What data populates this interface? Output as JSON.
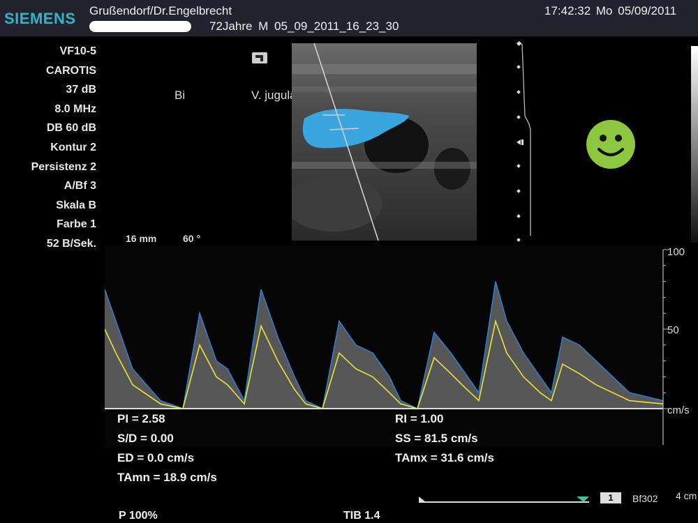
{
  "header": {
    "brand": "SIEMENS",
    "patient_name": "Grußendorf/Dr.Engelbrecht",
    "study_line": "72Jahre  M  05_09_2011_16_23_30",
    "datetime": "17:42:32  Mo  05/09/2011"
  },
  "params": [
    "VF10-5",
    "CAROTIS",
    "37 dB",
    "8.0 MHz",
    "DB 60 dB",
    "Kontur 2",
    "Persistenz 2",
    "A/Bf 3",
    "Skala B",
    "Farbe 1",
    "52 B/Sek."
  ],
  "image_labels": {
    "side": "Bi",
    "vessel": "V. jugular",
    "depth": "16 mm",
    "angle": "60 °"
  },
  "scale": {
    "ticks": [
      "100",
      "50"
    ],
    "unit": "cm/s"
  },
  "measurements": {
    "left": [
      "PI = 2.58",
      "S/D = 0.00",
      "ED = 0.0 cm/s",
      "TAmn = 18.9 cm/s"
    ],
    "right": [
      "RI = 1.00",
      "SS = 81.5 cm/s",
      "TAmx = 31.6 cm/s"
    ]
  },
  "footer": {
    "power": "P 100%",
    "tib": "TIB 1.4",
    "badge": "1",
    "preset": "Bf302",
    "depth": "4 cm"
  },
  "colors": {
    "brand": "#2fb7c9",
    "vessel_fill": "#3aa6e0",
    "envelope_max": "#2a7fd0",
    "envelope_mean": "#e8e43a",
    "status_smiley": "#8dc63f"
  },
  "chart_data": {
    "type": "line",
    "xlabel": "",
    "ylabel": "cm/s",
    "ylim": [
      -5,
      100
    ],
    "series": [
      {
        "x": [
          0,
          0.02,
          0.05,
          0.1,
          0.14,
          0.17,
          0.2,
          0.22,
          0.25,
          0.28,
          0.31,
          0.34,
          0.36,
          0.39,
          0.42,
          0.45,
          0.48,
          0.51,
          0.53,
          0.56,
          0.59,
          0.62,
          0.64,
          0.67,
          0.7,
          0.72,
          0.75,
          0.78,
          0.8,
          0.82,
          0.85,
          0.88,
          0.91,
          0.94,
          1.0
        ],
        "values": [
          75,
          55,
          25,
          5,
          0,
          60,
          30,
          25,
          5,
          75,
          45,
          20,
          5,
          0,
          55,
          40,
          35,
          20,
          5,
          0,
          48,
          35,
          25,
          10,
          80,
          55,
          35,
          20,
          10,
          45,
          40,
          30,
          20,
          10,
          5
        ]
      },
      {
        "x": [
          0,
          0.02,
          0.05,
          0.1,
          0.14,
          0.17,
          0.2,
          0.22,
          0.25,
          0.28,
          0.31,
          0.34,
          0.36,
          0.39,
          0.42,
          0.45,
          0.48,
          0.51,
          0.53,
          0.56,
          0.59,
          0.62,
          0.64,
          0.67,
          0.7,
          0.72,
          0.75,
          0.78,
          0.8,
          0.82,
          0.85,
          0.88,
          0.91,
          0.94,
          1.0
        ],
        "values": [
          50,
          35,
          15,
          3,
          0,
          40,
          20,
          15,
          3,
          52,
          30,
          12,
          3,
          0,
          35,
          25,
          20,
          10,
          3,
          0,
          32,
          22,
          15,
          5,
          55,
          35,
          20,
          10,
          5,
          28,
          22,
          15,
          10,
          5,
          3
        ]
      }
    ]
  }
}
